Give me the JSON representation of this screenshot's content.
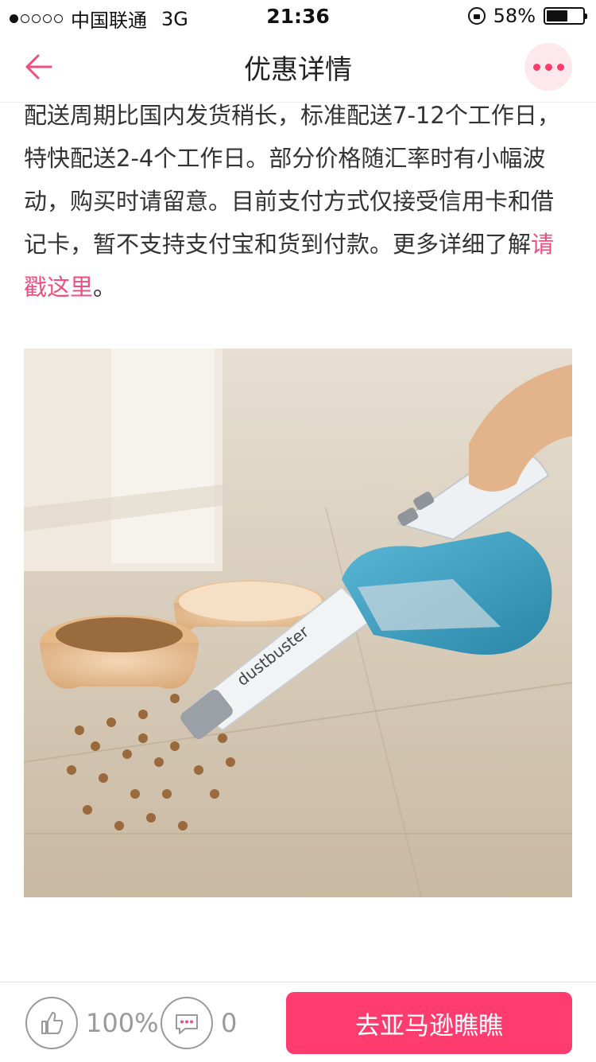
{
  "status_bar": {
    "carrier": "中国联通",
    "network": "3G",
    "time": "21:36",
    "battery_level": "58%",
    "signal_bars_filled": 1,
    "signal_bars_total": 5
  },
  "nav": {
    "title": "优惠详情",
    "accent_color": "#ff3b6b"
  },
  "article": {
    "text": "配送周期比国内发货稍长，标准配送7-12个工作日，特快配送2-4个工作日。部分价格随汇率时有小幅波动，购买时请留意。目前支付方式仅接受信用卡和借记卡，暂不支持支付宝和货到付款。更多详细了解",
    "link_text": "请戳这里",
    "suffix": "。"
  },
  "product_image": {
    "brand_label": "dustbuster"
  },
  "bottom_bar": {
    "like_percent": "100%",
    "comment_count": "0",
    "cta_label": "去亚马逊瞧瞧",
    "cta_color": "#ff3c6e"
  }
}
